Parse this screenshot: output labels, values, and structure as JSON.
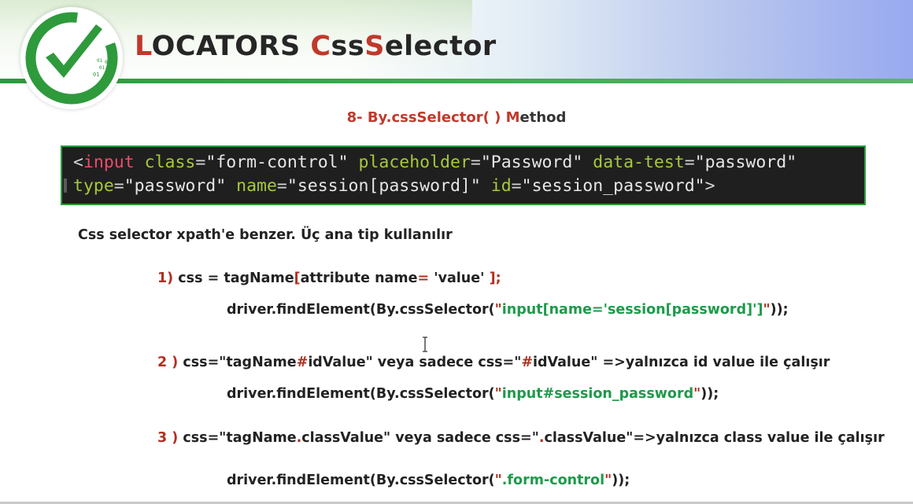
{
  "header": {
    "title_L": "L",
    "title_rest1": "OCATORS ",
    "title_C": "C",
    "title_ss": "ss",
    "title_S": "S",
    "title_rest2": "elector",
    "logo_digits": [
      "01",
      "01",
      "01",
      "01"
    ],
    "colors": {
      "accent_red": "#c0392b",
      "green_bar": "#2e9a3c"
    }
  },
  "subtitle": {
    "prefix": "8- By.cssSelector( ) ",
    "M": "M",
    "suffix": "ethod"
  },
  "code": {
    "line1": [
      {
        "t": "<",
        "k": "punct"
      },
      {
        "t": "input",
        "k": "tag"
      },
      {
        "t": " ",
        "k": "punct"
      },
      {
        "t": "class",
        "k": "attr"
      },
      {
        "t": "=",
        "k": "punct"
      },
      {
        "t": "\"form-control\"",
        "k": "val"
      },
      {
        "t": " ",
        "k": "punct"
      },
      {
        "t": "placeholder",
        "k": "attr"
      },
      {
        "t": "=",
        "k": "punct"
      },
      {
        "t": "\"Password\"",
        "k": "val"
      },
      {
        "t": " ",
        "k": "punct"
      },
      {
        "t": "data-test",
        "k": "attr"
      },
      {
        "t": "=",
        "k": "punct"
      },
      {
        "t": "\"password\"",
        "k": "val"
      }
    ],
    "line2": [
      {
        "t": "type",
        "k": "attr"
      },
      {
        "t": "=",
        "k": "punct"
      },
      {
        "t": "\"password\"",
        "k": "val"
      },
      {
        "t": " ",
        "k": "punct"
      },
      {
        "t": "name",
        "k": "attr"
      },
      {
        "t": "=",
        "k": "punct"
      },
      {
        "t": "\"session[password]\"",
        "k": "val"
      },
      {
        "t": " ",
        "k": "punct"
      },
      {
        "t": "id",
        "k": "attr"
      },
      {
        "t": "=",
        "k": "punct"
      },
      {
        "t": "\"session_password\"",
        "k": "val"
      },
      {
        "t": ">",
        "k": "punct"
      }
    ]
  },
  "intro": "Css selector xpath'e benzer. Üç ana tip kullanılır",
  "items": {
    "i1": {
      "num": "1)",
      "a": " css = tagName",
      "b": "[",
      "c": "attribute name",
      "d": "=",
      "e": " 'value' ",
      "f": "];",
      "code_pre": "driver.findElement(By.cssSelector(",
      "code_q1": "\"",
      "code_g": "input[name='session[password]']",
      "code_q2": "\"",
      "code_post": "));"
    },
    "i2": {
      "num": "2 )",
      "a": " css=",
      "b": "\"",
      "c": "tagName",
      "d": "#",
      "e": "idValue",
      "f": "\"",
      "g": " veya sadece css=",
      "h": "\"",
      "i": "#",
      "j": "idValue",
      "k": "\"",
      "l": " =>yalnızca id value ile çalışır",
      "code_pre": "driver.findElement(By.cssSelector(",
      "code_q1": "\"",
      "code_g": "input#session_password",
      "code_q2": "\"",
      "code_post": "));"
    },
    "i3": {
      "num": "3 )",
      "a": " css=",
      "b": "\"",
      "c": "tagName",
      "d": ".",
      "e": "classValue",
      "f": "\"",
      "g": " veya sadece css=",
      "h": "\"",
      "i": ".",
      "j": "classValue",
      "k": "\"",
      "l": "=>yalnızca class value ile çalışır",
      "code_pre": "driver.findElement(By.cssSelector(",
      "code_q1": "\"",
      "code_g": ".form-control",
      "code_q2": "\"",
      "code_post": "));"
    }
  }
}
